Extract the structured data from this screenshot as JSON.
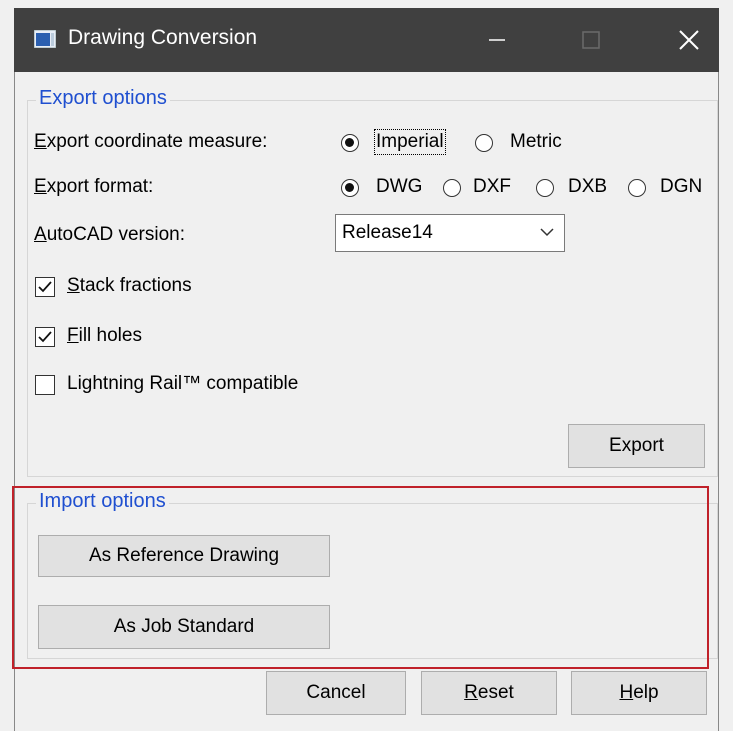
{
  "window": {
    "title": "Drawing Conversion",
    "minimize_glyph": "—",
    "maximize_glyph": "☐",
    "close_glyph": "✕"
  },
  "export": {
    "legend": "Export options",
    "coord_label": "Export coordinate measure:",
    "coord_options": [
      "Imperial",
      "Metric"
    ],
    "coord_selected": "Imperial",
    "format_label": "Export format:",
    "format_options": [
      "DWG",
      "DXF",
      "DXB",
      "DGN"
    ],
    "format_selected": "DWG",
    "version_label": "AutoCAD version:",
    "version_value": "Release14",
    "stack_label": "Stack fractions",
    "stack_checked": true,
    "fill_label": "Fill holes",
    "fill_checked": true,
    "rail_label": "Lightning Rail™ compatible",
    "rail_checked": false,
    "export_button": "Export"
  },
  "import": {
    "legend": "Import options",
    "ref_button": "As Reference Drawing",
    "job_button": "As Job Standard"
  },
  "footer": {
    "cancel": "Cancel",
    "reset": "Reset",
    "help": "Help"
  },
  "colors": {
    "titlebar": "#404040",
    "legend": "#1f4fd0",
    "highlight": "#c0212a"
  }
}
